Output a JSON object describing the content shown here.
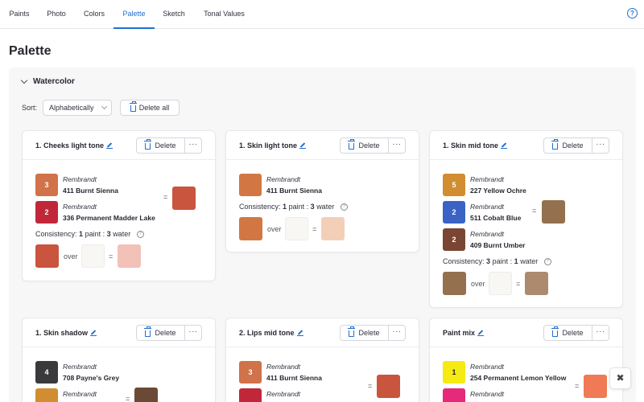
{
  "nav": {
    "tabs": [
      "Paints",
      "Photo",
      "Colors",
      "Palette",
      "Sketch",
      "Tonal Values"
    ],
    "active": "Palette",
    "help_icon": "question-circle-icon"
  },
  "page_title": "Palette",
  "section": {
    "title": "Watercolor",
    "sort_label": "Sort:",
    "sort_value": "Alphabetically",
    "delete_all_label": "Delete all"
  },
  "common": {
    "delete_label": "Delete",
    "more_label": "···",
    "equals": "=",
    "over": "over",
    "consistency_label": "Consistency:",
    "paint_word": "paint",
    "water_word": "water",
    "colon": ":"
  },
  "cards": [
    {
      "title": "1. Cheeks light tone",
      "paints": [
        {
          "parts": "3",
          "brand": "Rembrandt",
          "name": "411 Burnt Sienna",
          "color": "#d0724a"
        },
        {
          "parts": "2",
          "brand": "Rembrandt",
          "name": "336 Permanent Madder Lake",
          "color": "#c0283a"
        }
      ],
      "mix_color": "#c9553f",
      "consistency": {
        "paint": "1",
        "water": "3"
      },
      "water_color": "#f8f7f3",
      "result_color": "#f2c1b8"
    },
    {
      "title": "1. Skin light tone",
      "paints": [
        {
          "parts": "",
          "brand": "Rembrandt",
          "name": "411 Burnt Sienna",
          "color": "#d27744"
        }
      ],
      "consistency": {
        "paint": "1",
        "water": "3"
      },
      "water_color": "#f8f7f3",
      "result_color": "#f3cfb8"
    },
    {
      "title": "1. Skin mid tone",
      "paints": [
        {
          "parts": "5",
          "brand": "Rembrandt",
          "name": "227 Yellow Ochre",
          "color": "#d18d2f"
        },
        {
          "parts": "2",
          "brand": "Rembrandt",
          "name": "511 Cobalt Blue",
          "color": "#3a63c4"
        },
        {
          "parts": "2",
          "brand": "Rembrandt",
          "name": "409 Burnt Umber",
          "color": "#7a4633"
        }
      ],
      "mix_color": "#94704f",
      "consistency": {
        "paint": "3",
        "water": "1"
      },
      "water_color": "#f8f7f3",
      "result_color": "#ad8a6d"
    },
    {
      "title": "1. Skin shadow",
      "paints": [
        {
          "parts": "4",
          "brand": "Rembrandt",
          "name": "708 Payne's Grey",
          "color": "#3a3a3c"
        },
        {
          "parts": "",
          "brand": "Rembrandt",
          "name": "",
          "color": "#d18d2f"
        }
      ],
      "mix_color": "#6b4a35"
    },
    {
      "title": "2. Lips mid tone",
      "paints": [
        {
          "parts": "3",
          "brand": "Rembrandt",
          "name": "411 Burnt Sienna",
          "color": "#d0724a"
        },
        {
          "parts": "",
          "brand": "Rembrandt",
          "name": "",
          "color": "#c0283a"
        }
      ],
      "mix_color": "#c9553f"
    },
    {
      "title": "Paint mix",
      "paints": [
        {
          "parts": "1",
          "brand": "Rembrandt",
          "name": "254 Permanent Lemon Yellow",
          "color": "#f5ea12"
        },
        {
          "parts": "",
          "brand": "Rembrandt",
          "name": "",
          "color": "#e52a7a"
        }
      ],
      "mix_color": "#f07a55"
    }
  ],
  "fab_icon": "collapse-icon",
  "fab_label": "✖"
}
